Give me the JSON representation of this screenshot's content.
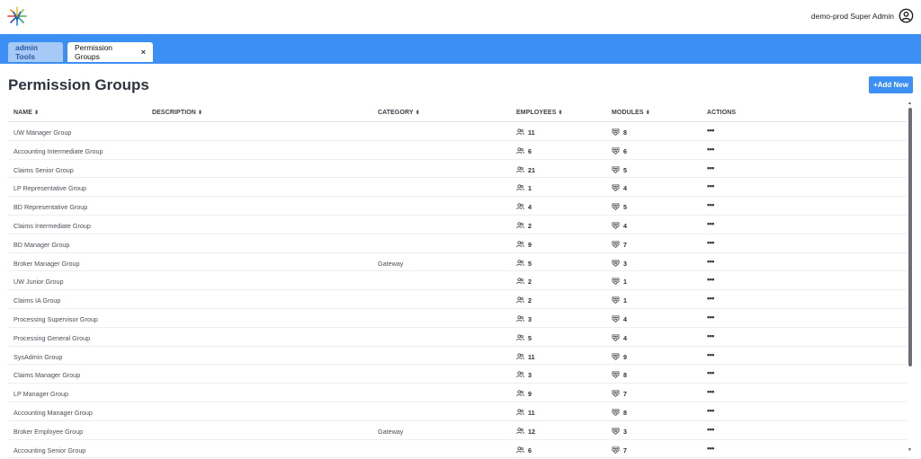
{
  "header": {
    "user_label": "demo-prod Super Admin"
  },
  "tabs": [
    {
      "label": "admin Tools"
    },
    {
      "label": "Permission Groups",
      "close": "×"
    }
  ],
  "page": {
    "title": "Permission Groups",
    "add_button": "+Add New"
  },
  "columns": {
    "name": "NAME",
    "description": "DESCRIPTION",
    "category": "CATEGORY",
    "employees": "EMPLOYEES",
    "modules": "MODULES",
    "actions": "ACTIONS",
    "sort_glyph": "⬍"
  },
  "rows": [
    {
      "name": "UW Manager Group",
      "description": "",
      "category": "",
      "employees": "11",
      "modules": "8",
      "actions": "•••"
    },
    {
      "name": "Accounting Intermediate Group",
      "description": "",
      "category": "",
      "employees": "6",
      "modules": "6",
      "actions": "•••"
    },
    {
      "name": "Claims Senior Group",
      "description": "",
      "category": "",
      "employees": "21",
      "modules": "5",
      "actions": "•••"
    },
    {
      "name": "LP Representative Group",
      "description": "",
      "category": "",
      "employees": "1",
      "modules": "4",
      "actions": "•••"
    },
    {
      "name": "BD Representative Group",
      "description": "",
      "category": "",
      "employees": "4",
      "modules": "5",
      "actions": "•••"
    },
    {
      "name": "Claims Intermediate Group",
      "description": "",
      "category": "",
      "employees": "2",
      "modules": "4",
      "actions": "•••"
    },
    {
      "name": "BD Manager Group",
      "description": "",
      "category": "",
      "employees": "9",
      "modules": "7",
      "actions": "•••"
    },
    {
      "name": "Broker Manager Group",
      "description": "",
      "category": "Gateway",
      "employees": "5",
      "modules": "3",
      "actions": "•••"
    },
    {
      "name": "UW Junior Group",
      "description": "",
      "category": "",
      "employees": "2",
      "modules": "1",
      "actions": "•••"
    },
    {
      "name": "Claims IA Group",
      "description": "",
      "category": "",
      "employees": "2",
      "modules": "1",
      "actions": "•••"
    },
    {
      "name": "Processing Supervisor Group",
      "description": "",
      "category": "",
      "employees": "3",
      "modules": "4",
      "actions": "•••"
    },
    {
      "name": "Processing General Group",
      "description": "",
      "category": "",
      "employees": "5",
      "modules": "4",
      "actions": "•••"
    },
    {
      "name": "SysAdmin Group",
      "description": "",
      "category": "",
      "employees": "11",
      "modules": "9",
      "actions": "•••"
    },
    {
      "name": "Claims Manager Group",
      "description": "",
      "category": "",
      "employees": "3",
      "modules": "8",
      "actions": "•••"
    },
    {
      "name": "LP Manager Group",
      "description": "",
      "category": "",
      "employees": "9",
      "modules": "7",
      "actions": "•••"
    },
    {
      "name": "Accounting Manager Group",
      "description": "",
      "category": "",
      "employees": "11",
      "modules": "8",
      "actions": "•••"
    },
    {
      "name": "Broker Employee Group",
      "description": "",
      "category": "Gateway",
      "employees": "12",
      "modules": "3",
      "actions": "•••"
    },
    {
      "name": "Accounting Senior Group",
      "description": "",
      "category": "",
      "employees": "6",
      "modules": "7",
      "actions": "•••"
    }
  ],
  "icons": {
    "logo": "brand-logo-icon",
    "user": "user-circle-icon",
    "employees": "users-icon",
    "modules": "modules-icon"
  },
  "colors": {
    "accent": "#3b8ff5",
    "tab_inactive": "#a7c9f5"
  }
}
